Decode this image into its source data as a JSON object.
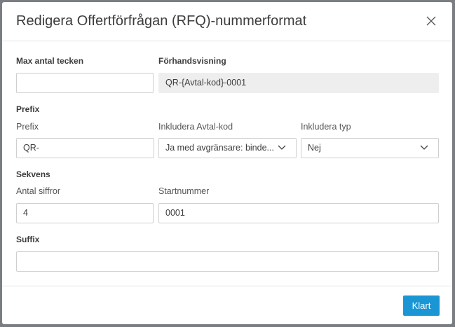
{
  "dialog": {
    "title": "Redigera Offertförfrågan (RFQ)-nummerformat",
    "close_icon": "close-icon"
  },
  "max_chars": {
    "label": "Max antal tecken",
    "value": ""
  },
  "preview": {
    "label": "Förhandsvisning",
    "value": "QR-{Avtal-kod}-0001"
  },
  "prefix_section": {
    "title": "Prefix",
    "prefix": {
      "label": "Prefix",
      "value": "QR-"
    },
    "include_contract_code": {
      "label": "Inkludera Avtal-kod",
      "value": "Ja med avgränsare: binde..."
    },
    "include_type": {
      "label": "Inkludera typ",
      "value": "Nej"
    }
  },
  "sequence_section": {
    "title": "Sekvens",
    "digits": {
      "label": "Antal siffror",
      "value": "4"
    },
    "start_number": {
      "label": "Startnummer",
      "value": "0001"
    }
  },
  "suffix_section": {
    "title": "Suffix",
    "value": ""
  },
  "footer": {
    "done_label": "Klart"
  },
  "colors": {
    "primary": "#1a96d4",
    "readonly_bg": "#eeeeee"
  }
}
